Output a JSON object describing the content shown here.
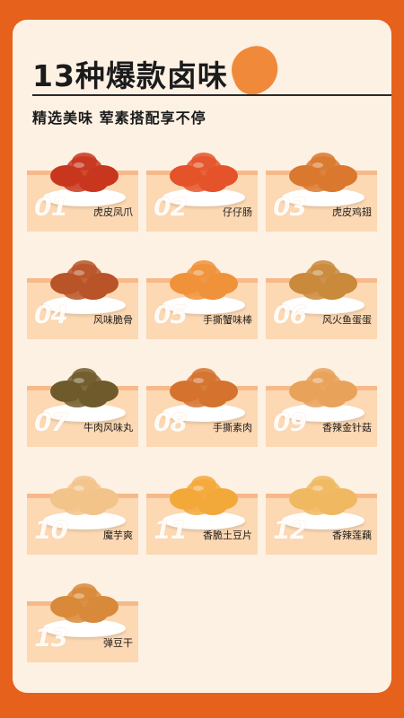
{
  "header": {
    "title": "13种爆款卤味",
    "subtitle": "精选美味 荤素搭配享不停"
  },
  "colors": {
    "background": "#e5611c",
    "panel": "#fdf1e4",
    "card": "#fcd8b3",
    "accent": "#f08a3a"
  },
  "items": [
    {
      "num": "01",
      "name": "虎皮凤爪",
      "food": "chicken-feet",
      "color": "#c8361e"
    },
    {
      "num": "02",
      "name": "仔仔肠",
      "food": "sausage",
      "color": "#e4532a"
    },
    {
      "num": "03",
      "name": "虎皮鸡翅",
      "food": "chicken-wings",
      "color": "#d9782e"
    },
    {
      "num": "04",
      "name": "风味脆骨",
      "food": "crispy-bone",
      "color": "#b85428"
    },
    {
      "num": "05",
      "name": "手撕蟹味棒",
      "food": "crab-stick",
      "color": "#f0923a"
    },
    {
      "num": "06",
      "name": "风火鱼蛋蛋",
      "food": "quail-egg",
      "color": "#c98a3c"
    },
    {
      "num": "07",
      "name": "牛肉风味丸",
      "food": "beef-ball",
      "color": "#6e5a2a"
    },
    {
      "num": "08",
      "name": "手撕素肉",
      "food": "veg-meat",
      "color": "#d4722e"
    },
    {
      "num": "09",
      "name": "香辣金针菇",
      "food": "enoki",
      "color": "#e8a25a"
    },
    {
      "num": "10",
      "name": "魔芋爽",
      "food": "konjac",
      "color": "#f2c48a"
    },
    {
      "num": "11",
      "name": "香脆土豆片",
      "food": "potato-chips",
      "color": "#f3a83a"
    },
    {
      "num": "12",
      "name": "香辣莲藕",
      "food": "lotus-root",
      "color": "#f0b860"
    },
    {
      "num": "13",
      "name": "弹豆干",
      "food": "tofu",
      "color": "#d9893a"
    }
  ]
}
